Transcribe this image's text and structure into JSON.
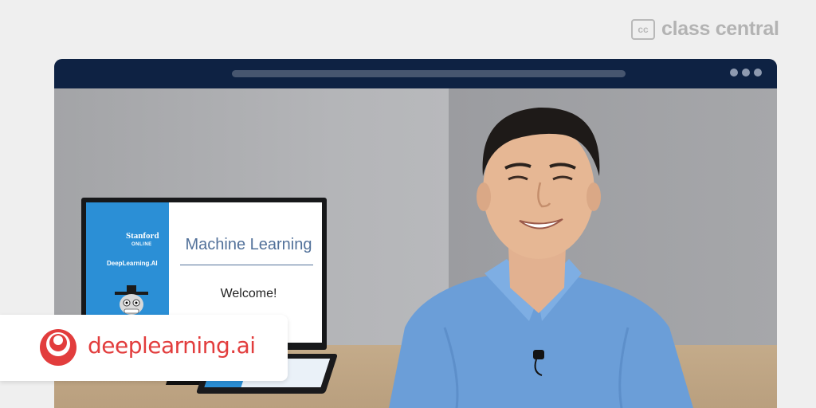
{
  "brand": {
    "badge": "cc",
    "name": "class central"
  },
  "window": {
    "address_bar": "",
    "dots": [
      "dot",
      "dot",
      "dot"
    ]
  },
  "video": {
    "slide": {
      "stanford": "Stanford",
      "online": "ONLINE",
      "deeplearning": "DeepLearning.AI",
      "title": "Machine Learning",
      "subtitle": "Welcome!"
    }
  },
  "overlay": {
    "logo_icon": "deeplearning-logo-icon",
    "text": "deeplearning.ai"
  },
  "colors": {
    "titlebar": "#0e2243",
    "shirt": "#6b9ed8",
    "brand_red": "#e23d3d",
    "slide_blue": "#2b8fd6"
  }
}
